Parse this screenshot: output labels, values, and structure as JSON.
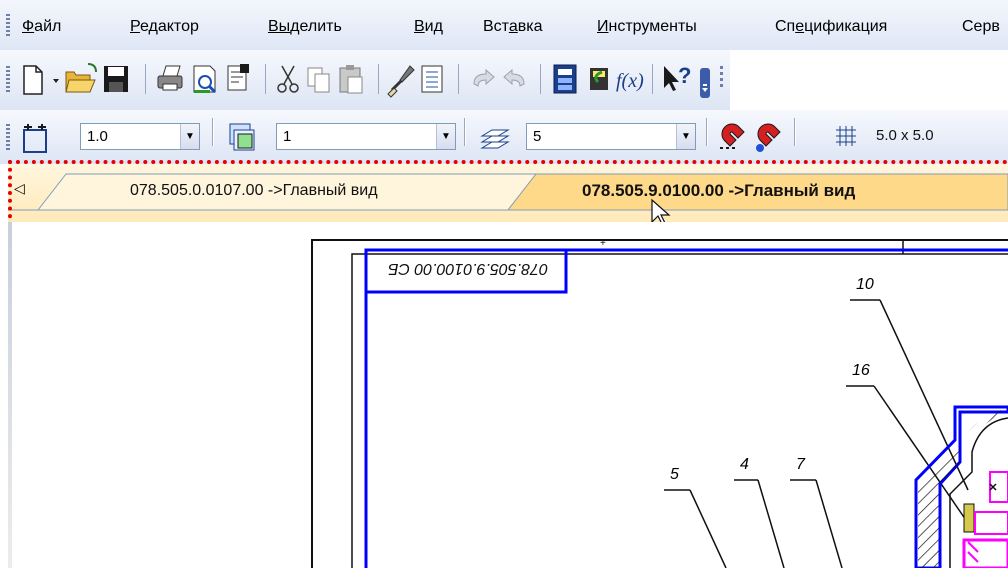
{
  "menu": {
    "items": [
      {
        "label": "Файл",
        "u": "Ф",
        "rest": "айл"
      },
      {
        "label": "Редактор",
        "u": "Р",
        "rest": "едактор"
      },
      {
        "label": "Выделить",
        "u": "Вы",
        "rest": "делить"
      },
      {
        "label": "Вид",
        "u": "В",
        "rest": "ид"
      },
      {
        "label": "Вставка",
        "pre": "Вст",
        "u": "а",
        "rest": "вка"
      },
      {
        "label": "Инструменты",
        "u": "И",
        "rest": "нструменты"
      },
      {
        "label": "Спецификация",
        "pre": "Сп",
        "u": "е",
        "rest": "цификация"
      },
      {
        "label": "Серв",
        "pre": "Серв",
        "u": "",
        "rest": ""
      }
    ]
  },
  "toolbar2": {
    "step_value": "1.0",
    "view_value": "1",
    "layer_value": "5",
    "grid_label": "5.0 x 5.0"
  },
  "tabs": {
    "tab1": "078.505.0.0107.00 ->Главный вид",
    "tab2": "078.505.9.0100.00 ->Главный вид"
  },
  "drawing": {
    "stamp_text": "078.505.9.0100.00 СБ",
    "callouts": [
      "10",
      "16",
      "5",
      "4",
      "7"
    ]
  },
  "colors": {
    "accent_blue": "#0000ff",
    "active_tab": "#ffd98a",
    "dotted_red": "#e60000",
    "magenta": "#ff00ff"
  }
}
